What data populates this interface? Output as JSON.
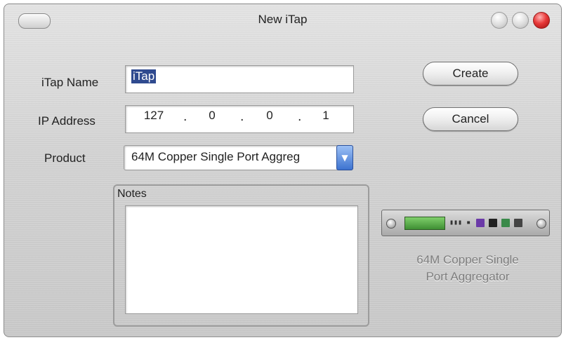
{
  "window": {
    "title": "New iTap"
  },
  "form": {
    "itap_name": {
      "label": "iTap Name",
      "value": "iTap"
    },
    "ip_address": {
      "label": "IP Address",
      "octets": [
        "127",
        "0",
        "0",
        "1"
      ],
      "separator": "."
    },
    "product": {
      "label": "Product",
      "selected": "64M Copper Single Port Aggreg"
    },
    "notes": {
      "label": "Notes",
      "value": ""
    }
  },
  "buttons": {
    "create_label": "Create",
    "cancel_label": "Cancel"
  },
  "device": {
    "caption_line1": "64M Copper Single",
    "caption_line2": "Port Aggregator"
  },
  "icons": {
    "window_pill": "toolbar-toggle-icon",
    "minimize": "minimize-icon",
    "maximize": "zoom-icon",
    "close": "close-icon",
    "dropdown": "chevron-down-icon"
  },
  "colors": {
    "selection": "#2f4a8f",
    "close_button": "#e83a3a",
    "dropdown_accent": "#3d73d0"
  }
}
